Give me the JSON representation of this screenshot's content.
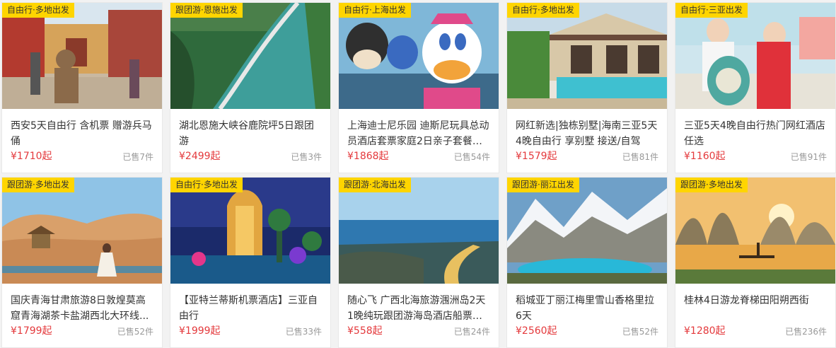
{
  "products": [
    {
      "tag": "自由行·多地出发",
      "title": "西安5天自由行 含机票 赠游兵马俑",
      "price": "¥1710起",
      "sold": "已售7件",
      "image": "terracotta-warrior-street-photo"
    },
    {
      "tag": "跟团游·恩施出发",
      "title": "湖北恩施大峡谷鹿院坪5日跟团游",
      "price": "¥2499起",
      "sold": "已售3件",
      "image": "canyon-river-walkway-photo"
    },
    {
      "tag": "自由行·上海出发",
      "title": "上海迪士尼乐园 迪斯尼玩具总动员酒店套票家庭2日亲子套餐合...",
      "price": "¥1868起",
      "sold": "已售54件",
      "image": "disney-characters-photo"
    },
    {
      "tag": "自由行·多地出发",
      "title": "网红新选|独栋别墅|海南三亚5天4晚自由行 享别墅 接送/自驾",
      "price": "¥1579起",
      "sold": "已售81件",
      "image": "villa-pool-photo"
    },
    {
      "tag": "自由行·三亚出发",
      "title": "三亚5天4晚自由行热门网红酒店任选",
      "price": "¥1160起",
      "sold": "已售91件",
      "image": "beach-couple-photo"
    },
    {
      "tag": "跟团游·多地出发",
      "title": "国庆青海甘肃旅游8日敦煌莫高窟青海湖茶卡盐湖西北大环线...",
      "price": "¥1799起",
      "sold": "已售52件",
      "image": "desert-pavilion-photo"
    },
    {
      "tag": "自由行·多地出发",
      "title": "【亚特兰蒂斯机票酒店】三亚自由行",
      "price": "¥1999起",
      "sold": "已售33件",
      "image": "atlantis-hotel-night-photo"
    },
    {
      "tag": "跟团游·北海出发",
      "title": "随心飞 广西北海旅游涠洲岛2天1晚纯玩跟团游海岛酒店船票二...",
      "price": "¥558起",
      "sold": "已售24件",
      "image": "coastal-boardwalk-photo"
    },
    {
      "tag": "跟团游·丽江出发",
      "title": "稻城亚丁丽江梅里雪山香格里拉6天",
      "price": "¥2560起",
      "sold": "已售52件",
      "image": "snow-mountain-lake-photo"
    },
    {
      "tag": "跟团游·多地出发",
      "title": "桂林4日游龙脊梯田阳朔西街",
      "price": "¥1280起",
      "sold": "已售236件",
      "image": "guilin-river-raft-photo"
    }
  ]
}
